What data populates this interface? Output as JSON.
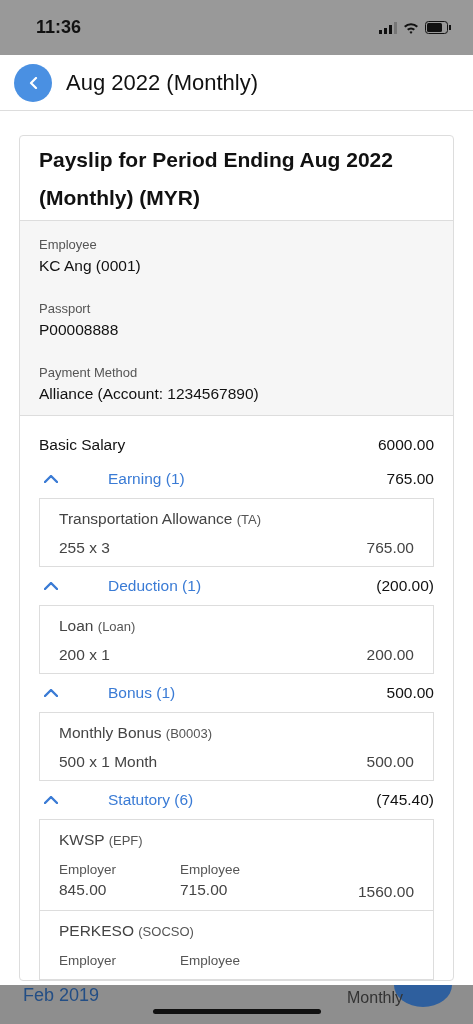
{
  "status_bar": {
    "time": "11:36"
  },
  "header": {
    "title": "Aug 2022 (Monthly)"
  },
  "payslip": {
    "title": "Payslip for Period Ending Aug 2022 (Monthly) (MYR)",
    "details": [
      {
        "label": "Employee",
        "value": "KC Ang (0001)"
      },
      {
        "label": "Passport",
        "value": "P00008888"
      },
      {
        "label": "Payment Method",
        "value": "Alliance (Account: 1234567890)"
      }
    ],
    "basic_salary": {
      "label": "Basic Salary",
      "amount": "6000.00"
    },
    "groups": [
      {
        "label": "Earning (1)",
        "total": "765.00",
        "expanded": true,
        "items": [
          {
            "kind": "simple",
            "name": "Transportation Allowance",
            "code": "(TA)",
            "formula": "255 x 3",
            "amount": "765.00"
          }
        ]
      },
      {
        "label": "Deduction (1)",
        "total": "(200.00)",
        "expanded": true,
        "items": [
          {
            "kind": "simple",
            "name": "Loan",
            "code": "(Loan)",
            "formula": "200 x 1",
            "amount": "200.00"
          }
        ]
      },
      {
        "label": "Bonus (1)",
        "total": "500.00",
        "expanded": true,
        "items": [
          {
            "kind": "simple",
            "name": "Monthly Bonus",
            "code": "(B0003)",
            "formula": "500 x 1 Month",
            "amount": "500.00"
          }
        ]
      },
      {
        "label": "Statutory (6)",
        "total": "(745.40)",
        "expanded": true,
        "items": [
          {
            "kind": "split",
            "name": "KWSP",
            "code": "(EPF)",
            "employer_label": "Employer",
            "employer": "845.00",
            "employee_label": "Employee",
            "employee": "715.00",
            "amount": "1560.00"
          },
          {
            "kind": "split",
            "name": "PERKESO",
            "code": "(SOCSO)",
            "employer_label": "Employer",
            "employee_label": "Employee"
          }
        ]
      }
    ]
  },
  "background": {
    "period": "Feb 2019",
    "frequency": "Monthly"
  }
}
